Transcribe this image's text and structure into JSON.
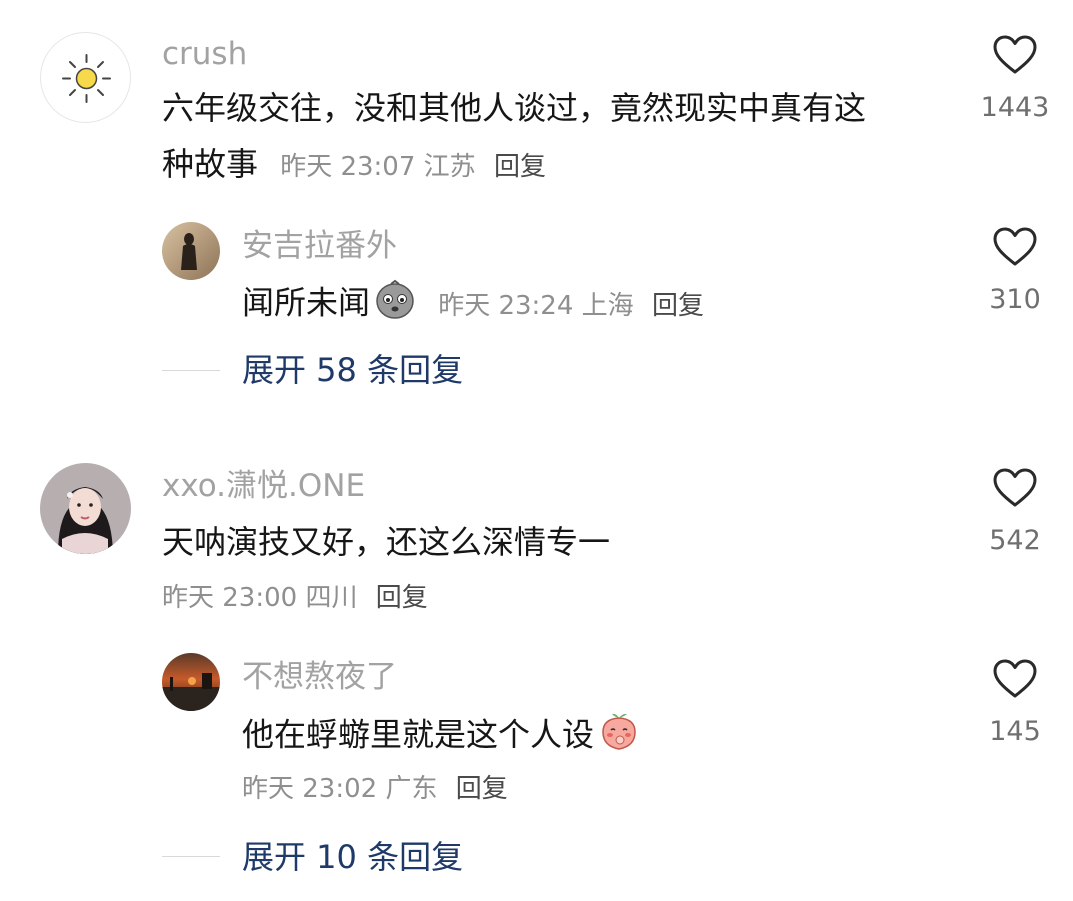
{
  "colors": {
    "name_gray": "#a2a2a2",
    "text_black": "#161616",
    "meta_gray": "#8f8f8f",
    "expand_blue": "#1f3a68",
    "heart_gray": "#2a2a2a"
  },
  "comments": [
    {
      "username": "crush",
      "avatar_icon": "sun-icon",
      "text_line1": "六年级交往，没和其他人谈过，竟然现实中真有这",
      "text_line2": "种故事",
      "time": "昨天 23:07",
      "location": "江苏",
      "reply_label": "回复",
      "likes": "1443",
      "replies": [
        {
          "username": "安吉拉番外",
          "avatar_icon": "silhouette-photo-avatar",
          "text": "闻所未闻",
          "emoji_icon": "crying-face-emoji",
          "time": "昨天 23:24",
          "location": "上海",
          "reply_label": "回复",
          "likes": "310"
        }
      ],
      "expand_label": "展开 58 条回复"
    },
    {
      "username": "xxo.潇悦.ONE",
      "avatar_icon": "woman-portrait-avatar",
      "text": "天呐演技又好，还这么深情专一",
      "time": "昨天 23:00",
      "location": "四川",
      "reply_label": "回复",
      "likes": "542",
      "replies": [
        {
          "username": "不想熬夜了",
          "avatar_icon": "sunset-photo-avatar",
          "text": "他在蜉蝣里就是这个人设",
          "emoji_icon": "shy-peach-emoji",
          "time": "昨天 23:02",
          "location": "广东",
          "reply_label": "回复",
          "likes": "145"
        }
      ],
      "expand_label": "展开 10 条回复"
    }
  ]
}
